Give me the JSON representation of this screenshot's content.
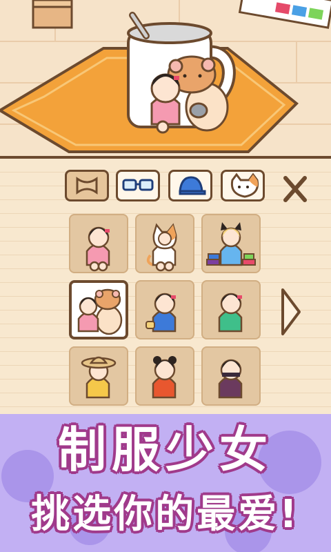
{
  "ui": {
    "accent": "#6c4a2e",
    "background": "#f7e6cf",
    "promo_bg": "#b8a7f0",
    "promo_text": "#ffffff",
    "promo_outline": "#a03a8b"
  },
  "tabs": [
    {
      "icon": "bow-icon",
      "active": true
    },
    {
      "icon": "glasses-icon",
      "active": false
    },
    {
      "icon": "cap-icon",
      "active": false
    },
    {
      "icon": "cat-face-icon",
      "active": false
    }
  ],
  "grid": {
    "selected_index": 3,
    "items": [
      {
        "name": "girl-pink-dress"
      },
      {
        "name": "girl-cat-costume"
      },
      {
        "name": "girl-blue-ribbons-with-books"
      },
      {
        "name": "girl-pink-with-hamster"
      },
      {
        "name": "girl-blue-dress"
      },
      {
        "name": "girl-green-dress"
      },
      {
        "name": "girl-straw-hat-yellow"
      },
      {
        "name": "girl-red-qipao"
      },
      {
        "name": "girl-ninja-purple"
      }
    ]
  },
  "promo": {
    "title": "制服少女",
    "subtitle": "挑选你的最爱!"
  }
}
